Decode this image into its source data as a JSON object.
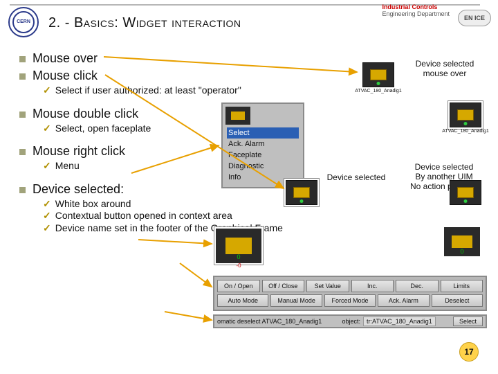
{
  "header": {
    "title": "2. - Basics: Widget interaction",
    "industrial_controls": "Industrial Controls",
    "eng_dept": "Engineering Department",
    "badge": "EN ICE",
    "cern": "CERN"
  },
  "bullets": [
    {
      "text": "Mouse over"
    },
    {
      "text": "Mouse click",
      "subs": [
        {
          "text": "Select if user authorized: at least \"operator\""
        }
      ]
    },
    {
      "text": "Mouse double click",
      "subs": [
        {
          "text": "Select, open faceplate"
        }
      ]
    },
    {
      "text": "Mouse right click",
      "subs": [
        {
          "text": "Menu"
        }
      ]
    },
    {
      "text": "Device selected:",
      "subs": [
        {
          "text": "White box around"
        },
        {
          "text": "Contextual button opened in context area"
        },
        {
          "text": "Device name set in the footer of the Graphical Frame"
        }
      ]
    }
  ],
  "rightLabels": {
    "r1a": "Device selected",
    "r1b": "mouse over",
    "r2": "Device selected",
    "r3a": "Device selected",
    "r3b": "By another UIM",
    "r3c": "No action possible"
  },
  "deviceLabel": "ATVAC_180_Anadig1",
  "contextMenu": [
    "Select",
    "Ack. Alarm",
    "Faceplate",
    "Diagnostic",
    "Info"
  ],
  "buttonBar": {
    "row1": [
      "On / Open",
      "Off / Close",
      "Set Value",
      "Inc.",
      "Dec.",
      "Limits"
    ],
    "row2": [
      "Auto Mode",
      "Manual Mode",
      "Forced Mode",
      "Ack. Alarm",
      "Deselect"
    ]
  },
  "footer": {
    "auto_deselect": "omatic deselect ATVAC_180_Anadig1",
    "object": "object:",
    "object_val": "tr:ATVAC_180_Anadig1",
    "select": "Select"
  },
  "pageNumber": "17",
  "green0": "0",
  "red0": "-0"
}
